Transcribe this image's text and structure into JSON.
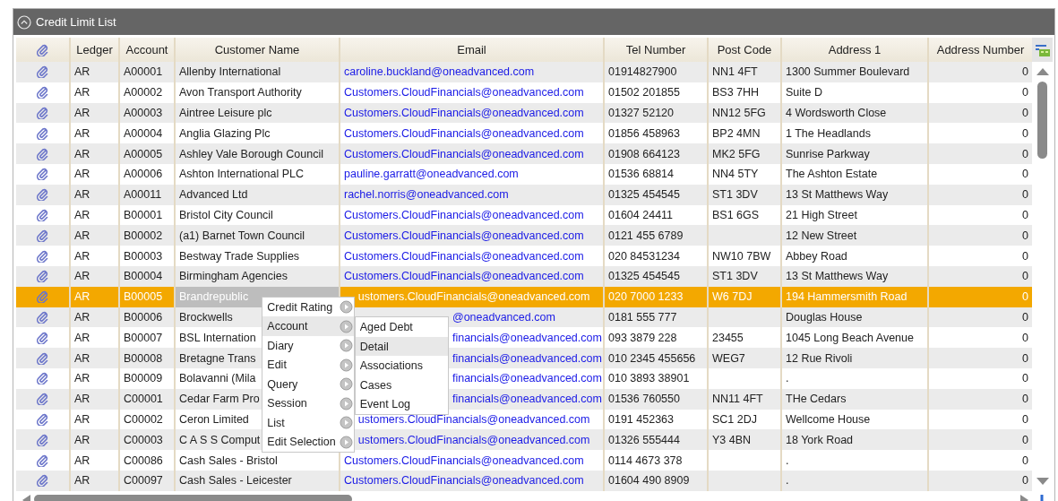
{
  "panel": {
    "title": "Credit Limit List"
  },
  "table": {
    "columns": [
      "Ledger",
      "Account",
      "Customer Name",
      "Email",
      "Tel Number",
      "Post Code",
      "Address 1",
      "Address Number"
    ],
    "rows": [
      {
        "selected": false,
        "ledger": "AR",
        "account": "A00001",
        "customer_name": "Allenby International",
        "email": "caroline.buckland@oneadvanced.com",
        "tel": "01914827900",
        "post_code": "NN1 4FT",
        "address_1": "1300 Summer Boulevard",
        "address_number": "0"
      },
      {
        "selected": false,
        "ledger": "AR",
        "account": "A00002",
        "customer_name": "Avon Transport Authority",
        "email": "Customers.CloudFinancials@oneadvanced.com",
        "tel": "01502 201855",
        "post_code": "BS3 7HH",
        "address_1": "Suite D",
        "address_number": "0"
      },
      {
        "selected": false,
        "ledger": "AR",
        "account": "A00003",
        "customer_name": "Aintree Leisure plc",
        "email": "Customers.CloudFinancials@oneadvanced.com",
        "tel": "01327 52120",
        "post_code": "NN12 5FG",
        "address_1": "4 Wordsworth Close",
        "address_number": "0"
      },
      {
        "selected": false,
        "ledger": "AR",
        "account": "A00004",
        "customer_name": "Anglia Glazing Plc",
        "email": "Customers.CloudFinancials@oneadvanced.com",
        "tel": "01856 458963",
        "post_code": "BP2 4MN",
        "address_1": "1 The Headlands",
        "address_number": "0"
      },
      {
        "selected": false,
        "ledger": "AR",
        "account": "A00005",
        "customer_name": "Ashley Vale Borough Council",
        "email": "Customers.CloudFinancials@oneadvanced.com",
        "tel": "01908 664123",
        "post_code": "MK2 5FG",
        "address_1": "Sunrise Parkway",
        "address_number": "0"
      },
      {
        "selected": false,
        "ledger": "AR",
        "account": "A00006",
        "customer_name": "Ashton International PLC",
        "email": "pauline.garratt@oneadvanced.com",
        "tel": "01536 68814",
        "post_code": "NN4 5TY",
        "address_1": "The Ashton Estate",
        "address_number": "0"
      },
      {
        "selected": false,
        "ledger": "AR",
        "account": "A00011",
        "customer_name": "Advanced Ltd",
        "email": "rachel.norris@oneadvanced.com",
        "tel": "01325 454545",
        "post_code": "ST1 3DV",
        "address_1": "13 St Matthews Way",
        "address_number": "0"
      },
      {
        "selected": false,
        "ledger": "AR",
        "account": "B00001",
        "customer_name": "Bristol City Council",
        "email": "Customers.CloudFinancials@oneadvanced.com",
        "tel": "01604 24411",
        "post_code": "BS1 6GS",
        "address_1": "21 High Street",
        "address_number": "0"
      },
      {
        "selected": false,
        "ledger": "AR",
        "account": "B00002",
        "customer_name": "(a1) Barnet Town Council",
        "email": "Customers.CloudFinancials@oneadvanced.com",
        "tel": "0121 455 6789",
        "address_1": "12 New Street",
        "address_number": "0"
      },
      {
        "selected": false,
        "ledger": "AR",
        "account": "B00003",
        "customer_name": "Bestway Trade Supplies",
        "email": "Customers.CloudFinancials@oneadvanced.com",
        "tel": "020 84531234",
        "post_code": "NW10 7BW",
        "address_1": "Abbey Road",
        "address_number": "0"
      },
      {
        "selected": false,
        "ledger": "AR",
        "account": "B00004",
        "customer_name": "Birmingham Agencies",
        "email": "Customers.CloudFinancials@oneadvanced.com",
        "tel": "01325 454545",
        "post_code": "ST1 3DV",
        "address_1": "13 St Matthews Way",
        "address_number": "0"
      },
      {
        "selected": true,
        "ledger": "AR",
        "account": "B00005",
        "customer_name": "Brandrepublic",
        "email": "ustomers.CloudFinancials@oneadvanced.com",
        "tel": "020 7000 1233",
        "post_code": "W6 7DJ",
        "address_1": "194 Hammersmith Road",
        "address_number": "0"
      },
      {
        "selected": false,
        "ledger": "AR",
        "account": "B00006",
        "customer_name": "Brockwells",
        "email": "@oneadvanced.com",
        "tel": "0181 555 777",
        "address_1": "Douglas House",
        "address_number": "0"
      },
      {
        "selected": false,
        "ledger": "AR",
        "account": "B00007",
        "customer_name": "BSL Internation",
        "email": "financials@oneadvanced.com",
        "tel": "093 3879 228",
        "post_code": "23455",
        "address_1": "1045 Long Beach Avenue",
        "address_number": "0"
      },
      {
        "selected": false,
        "ledger": "AR",
        "account": "B00008",
        "customer_name": "Bretagne Trans",
        "email": "financials@oneadvanced.com",
        "tel": "010 2345 455656",
        "post_code": "WEG7",
        "address_1": "12 Rue Rivoli",
        "address_number": "0"
      },
      {
        "selected": false,
        "ledger": "AR",
        "account": "B00009",
        "customer_name": "Bolavanni (Mila",
        "email": "financials@oneadvanced.com",
        "tel": "010 3893 38901",
        "address_1": ".",
        "address_number": "0"
      },
      {
        "selected": false,
        "ledger": "AR",
        "account": "C00001",
        "customer_name": "Cedar Farm Pro",
        "email": "financials@oneadvanced.com",
        "tel": "01536 760550",
        "post_code": "NN11 4FT",
        "address_1": "THe Cedars",
        "address_number": "0"
      },
      {
        "selected": false,
        "ledger": "AR",
        "account": "C00002",
        "customer_name": "Ceron Limited",
        "email": "ustomers.CloudFinancials@oneadvanced.com",
        "tel": "0191 452363",
        "post_code": "SC1 2DJ",
        "address_1": "Wellcome House",
        "address_number": "0"
      },
      {
        "selected": false,
        "ledger": "AR",
        "account": "C00003",
        "customer_name": "C A S S Comput",
        "email": "ustomers.CloudFinancials@oneadvanced.com",
        "tel": "01326 555444",
        "post_code": "Y3 4BN",
        "address_1": "18 York Road",
        "address_number": "0"
      },
      {
        "selected": false,
        "ledger": "AR",
        "account": "C00086",
        "customer_name": "Cash Sales - Bristol",
        "email": "Customers.CloudFinancials@oneadvanced.com",
        "tel": "0114 4673 378",
        "address_1": ".",
        "address_number": "0"
      },
      {
        "selected": false,
        "ledger": "AR",
        "account": "C00097",
        "customer_name": "Cash Sales - Leicester",
        "email": "Customers.CloudFinancials@oneadvanced.com",
        "tel": "01604 490 8909",
        "address_1": ".",
        "address_number": "0"
      }
    ]
  },
  "context_menu": {
    "items": [
      {
        "label": "Credit Rating",
        "expanded": false
      },
      {
        "label": "Account",
        "expanded": true
      },
      {
        "label": "Diary",
        "expanded": false
      },
      {
        "label": "Edit",
        "expanded": false
      },
      {
        "label": "Query",
        "expanded": false
      },
      {
        "label": "Session",
        "expanded": false
      },
      {
        "label": "List",
        "expanded": false
      },
      {
        "label": "Edit Selection",
        "expanded": false
      }
    ],
    "submenu": [
      {
        "label": "Aged Debt",
        "selected": false
      },
      {
        "label": "Detail",
        "selected": true
      },
      {
        "label": "Associations",
        "selected": false
      },
      {
        "label": "Cases",
        "selected": false
      },
      {
        "label": "Event Log",
        "selected": false
      }
    ]
  }
}
